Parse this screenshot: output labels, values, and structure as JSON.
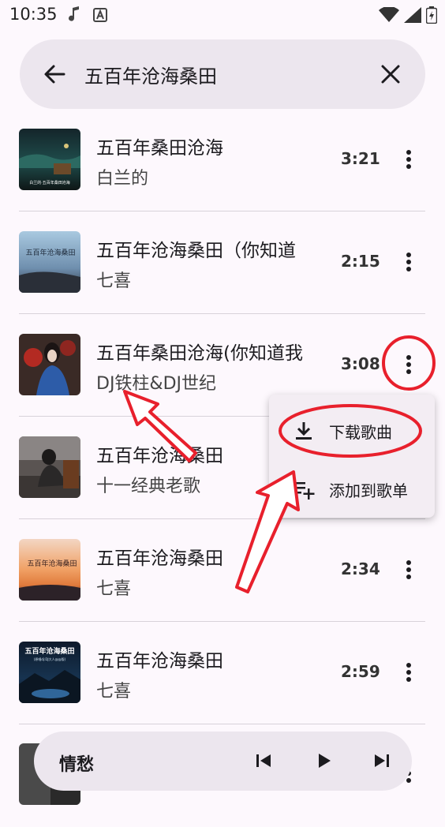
{
  "status_bar": {
    "time": "10:35"
  },
  "search": {
    "query": "五百年沧海桑田"
  },
  "songs": [
    {
      "title": "五百年桑田沧海",
      "artist": "白兰的",
      "duration": "3:21"
    },
    {
      "title": "五百年沧海桑田（你知道",
      "artist": "七喜",
      "duration": "2:15"
    },
    {
      "title": "五百年桑田沧海(你知道我",
      "artist": "DJ铁柱&DJ世纪",
      "duration": "3:08"
    },
    {
      "title": "五百年沧海桑田",
      "artist": "十一经典老歌",
      "duration": ""
    },
    {
      "title": "五百年沧海桑田",
      "artist": "七喜",
      "duration": "2:34"
    },
    {
      "title": "五百年沧海桑田",
      "artist": "七喜",
      "duration": "2:59"
    }
  ],
  "cover_text": {
    "c1": "白兰的·五百年桑田沧海",
    "c2": "五百年沧海桑田",
    "c5": "五百年沧海桑田",
    "c6_title": "五百年沧海桑田",
    "c6_sub": "(原唱dj:DJ大人@@版)"
  },
  "context_menu": {
    "download": "下载歌曲",
    "add_to_playlist": "添加到歌单"
  },
  "player": {
    "title": "情愁"
  },
  "colors": {
    "accent_annotation": "#e8202c",
    "surface": "#ece6ee",
    "background": "#fdf8fd"
  }
}
